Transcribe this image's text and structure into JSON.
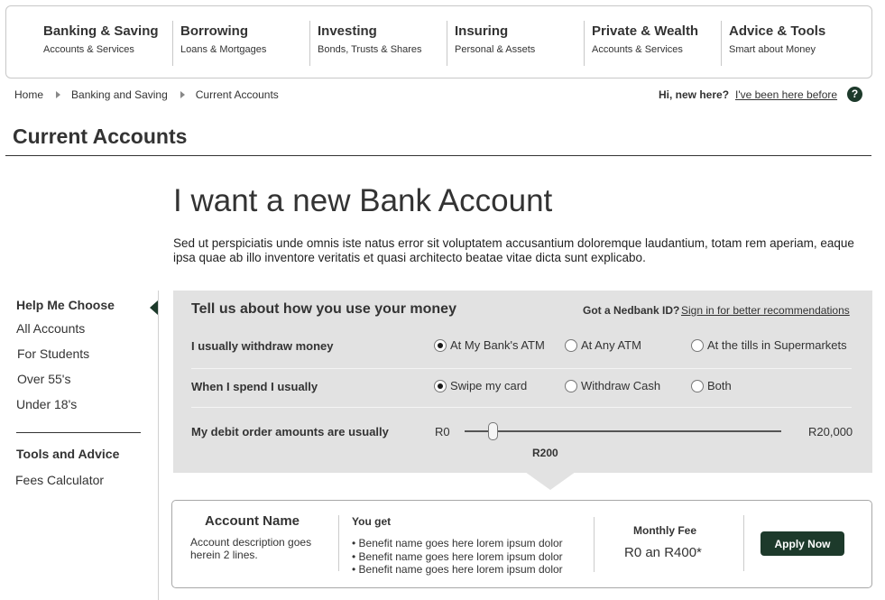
{
  "nav": [
    {
      "title": "Banking & Saving",
      "sub": "Accounts & Services"
    },
    {
      "title": "Borrowing",
      "sub": "Loans & Mortgages"
    },
    {
      "title": "Investing",
      "sub": "Bonds, Trusts & Shares"
    },
    {
      "title": "Insuring",
      "sub": "Personal & Assets"
    },
    {
      "title": "Private & Wealth",
      "sub": "Accounts & Services"
    },
    {
      "title": "Advice & Tools",
      "sub": "Smart about Money"
    }
  ],
  "breadcrumb": [
    "Home",
    "Banking and Saving",
    "Current Accounts"
  ],
  "greeting": {
    "hi": "Hi, new here?",
    "returning": "I've been here before",
    "help": "?"
  },
  "page_title": "Current Accounts",
  "hero": {
    "title": "I want a new Bank Account",
    "intro": "Sed ut perspiciatis unde omnis iste natus error sit voluptatem accusantium doloremque laudantium, totam rem aperiam, eaque ipsa quae ab illo inventore veritatis et quasi architecto beatae vitae dicta sunt explicabo."
  },
  "sidebar": {
    "heading1": "Help Me Choose",
    "items": [
      "All Accounts",
      "For Students",
      "Over 55's",
      "Under 18's"
    ],
    "heading2": "Tools and Advice",
    "tools": [
      "Fees Calculator"
    ]
  },
  "questionnaire": {
    "title": "Tell us about how you use your money",
    "id_question": "Got a Nedbank ID?",
    "sign_in": "Sign in for better recommendations",
    "q1": {
      "label": "I usually withdraw money",
      "options": [
        "At My Bank's ATM",
        "At Any ATM",
        "At the tills in Supermarkets"
      ],
      "selected": 0
    },
    "q2": {
      "label": "When I spend I usually",
      "options": [
        "Swipe my card",
        "Withdraw Cash",
        "Both"
      ],
      "selected": 0
    },
    "q3": {
      "label": "My debit order amounts are usually",
      "min_label": "R0",
      "max_label": "R20,000",
      "min": 0,
      "max": 20000,
      "value": 1800,
      "value_label": "R200"
    }
  },
  "account": {
    "name": "Account Name",
    "description": "Account description goes herein 2 lines.",
    "you_get": "You get",
    "benefits": [
      "Benefit name goes here lorem ipsum dolor",
      "Benefit name goes here lorem ipsum dolor",
      "Benefit name goes here lorem ipsum dolor"
    ],
    "fee_label": "Monthly Fee",
    "fee_value": "R0 an R400*",
    "apply_label": "Apply Now"
  },
  "colors": {
    "accent": "#1d3a2b",
    "panel": "#e2e2e2"
  }
}
